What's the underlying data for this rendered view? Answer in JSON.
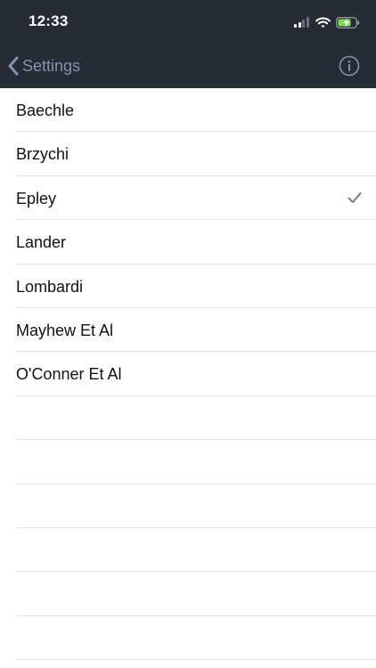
{
  "status": {
    "time": "12:33",
    "signal_icon": "cellular-signal-icon",
    "wifi_icon": "wifi-icon",
    "battery_icon": "battery-charging-icon"
  },
  "nav": {
    "back_label": "Settings",
    "back_icon": "chevron-left-icon",
    "info_icon": "info-icon"
  },
  "options": [
    {
      "label": "Baechle",
      "selected": false
    },
    {
      "label": "Brzychi",
      "selected": false
    },
    {
      "label": "Epley",
      "selected": true
    },
    {
      "label": "Lander",
      "selected": false
    },
    {
      "label": "Lombardi",
      "selected": false
    },
    {
      "label": "Mayhew Et Al",
      "selected": false
    },
    {
      "label": "O'Conner Et Al",
      "selected": false
    }
  ],
  "colors": {
    "header_bg": "#262b35",
    "nav_tint": "#8792a8",
    "checkmark": "#6f7e9e",
    "separator": "#e2e2e4",
    "battery_fill": "#7ed957"
  }
}
